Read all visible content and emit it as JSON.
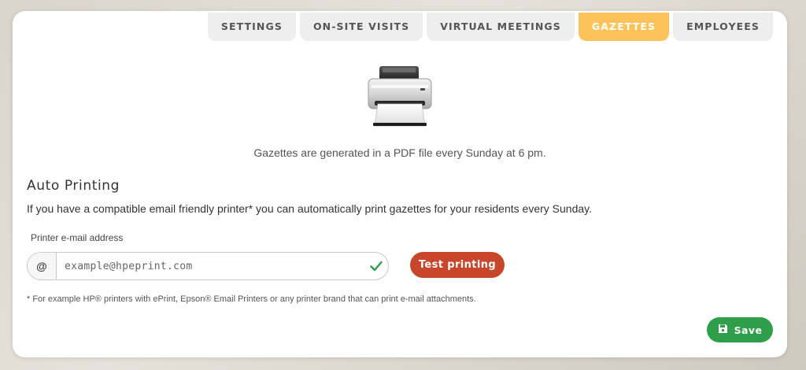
{
  "tabs": [
    {
      "label": "SETTINGS"
    },
    {
      "label": "ON-SITE VISITS"
    },
    {
      "label": "VIRTUAL MEETINGS"
    },
    {
      "label": "GAZETTES",
      "active": true
    },
    {
      "label": "EMPLOYEES"
    }
  ],
  "header": {
    "icon": "printer-icon",
    "note": "Gazettes are generated in a PDF file every Sunday at 6 pm."
  },
  "auto_printing": {
    "title": "Auto Printing",
    "description": "If you have a compatible email friendly printer* you can automatically print gazettes for your residents every Sunday.",
    "field_label": "Printer e-mail address",
    "at_symbol": "@",
    "email_placeholder": "example@hpeprint.com",
    "email_value": "",
    "valid_icon": "check-icon",
    "test_button": "Test printing",
    "footnote": "* For example HP® printers with ePrint, Epson® Email Printers or any printer brand that can print e-mail attachments."
  },
  "save_button": {
    "label": "Save",
    "icon": "floppy-disk-icon"
  },
  "colors": {
    "active_tab": "#fcc35a",
    "tab": "#eeeeee",
    "test_button": "#c8472b",
    "save_button": "#2e9e4a",
    "valid_check": "#2e9e4a"
  }
}
